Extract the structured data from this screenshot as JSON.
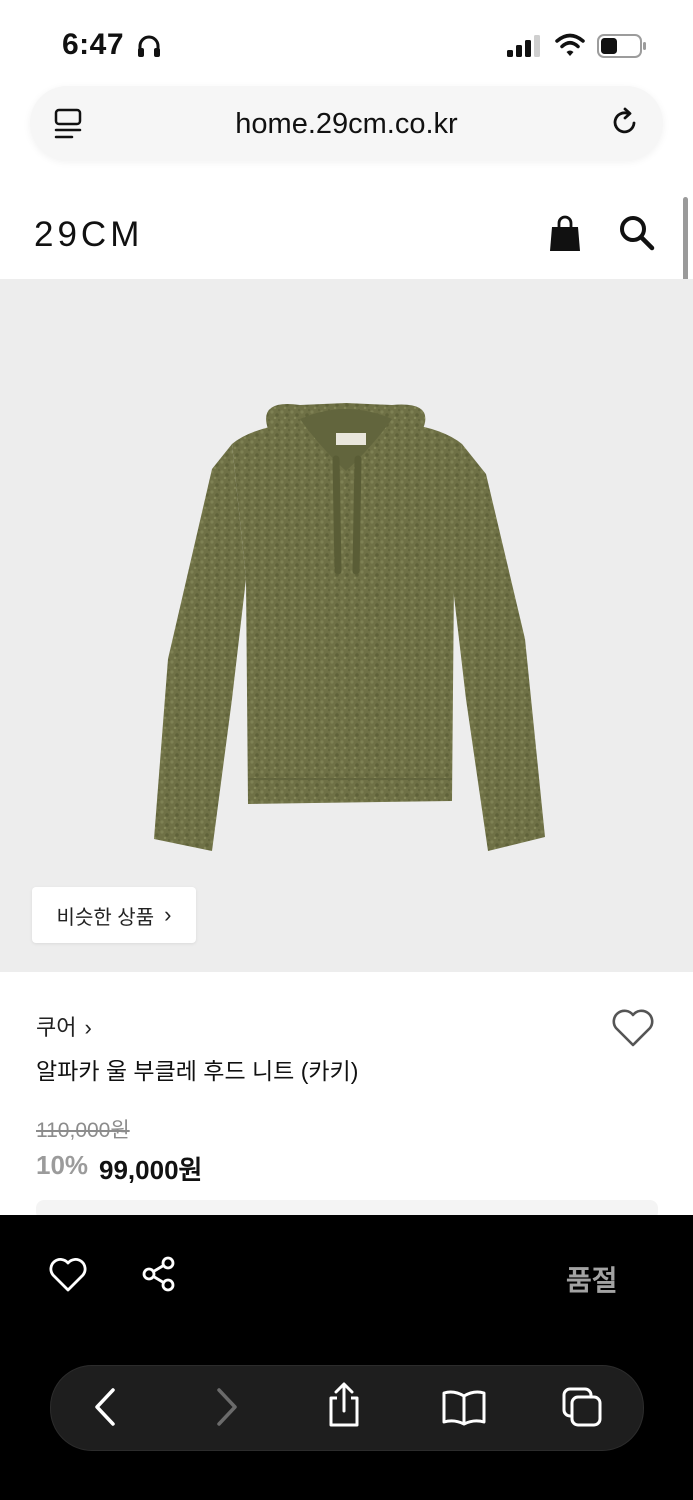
{
  "status_bar": {
    "time": "6:47"
  },
  "browser": {
    "url": "home.29cm.co.kr"
  },
  "site": {
    "logo": "29CM"
  },
  "product": {
    "similar_button": "비슷한 상품",
    "brand": "쿠어",
    "name": "알파카 울 부클레 후드 니트 (카키)",
    "original_price": "110,000원",
    "discount_rate": "10%",
    "sale_price": "99,000원",
    "sold_out_label": "품절",
    "knit_color": "#6f7146"
  },
  "icons": {
    "status": [
      "headphones-icon",
      "signal-icon",
      "wifi-icon",
      "battery-icon"
    ],
    "browser": [
      "tab-menu-icon",
      "reload-icon",
      "back-icon",
      "forward-icon",
      "share-sheet-icon",
      "bookmarks-icon",
      "tabs-icon"
    ],
    "site": [
      "shopping-bag-icon",
      "search-icon",
      "heart-icon",
      "share-icon"
    ]
  }
}
